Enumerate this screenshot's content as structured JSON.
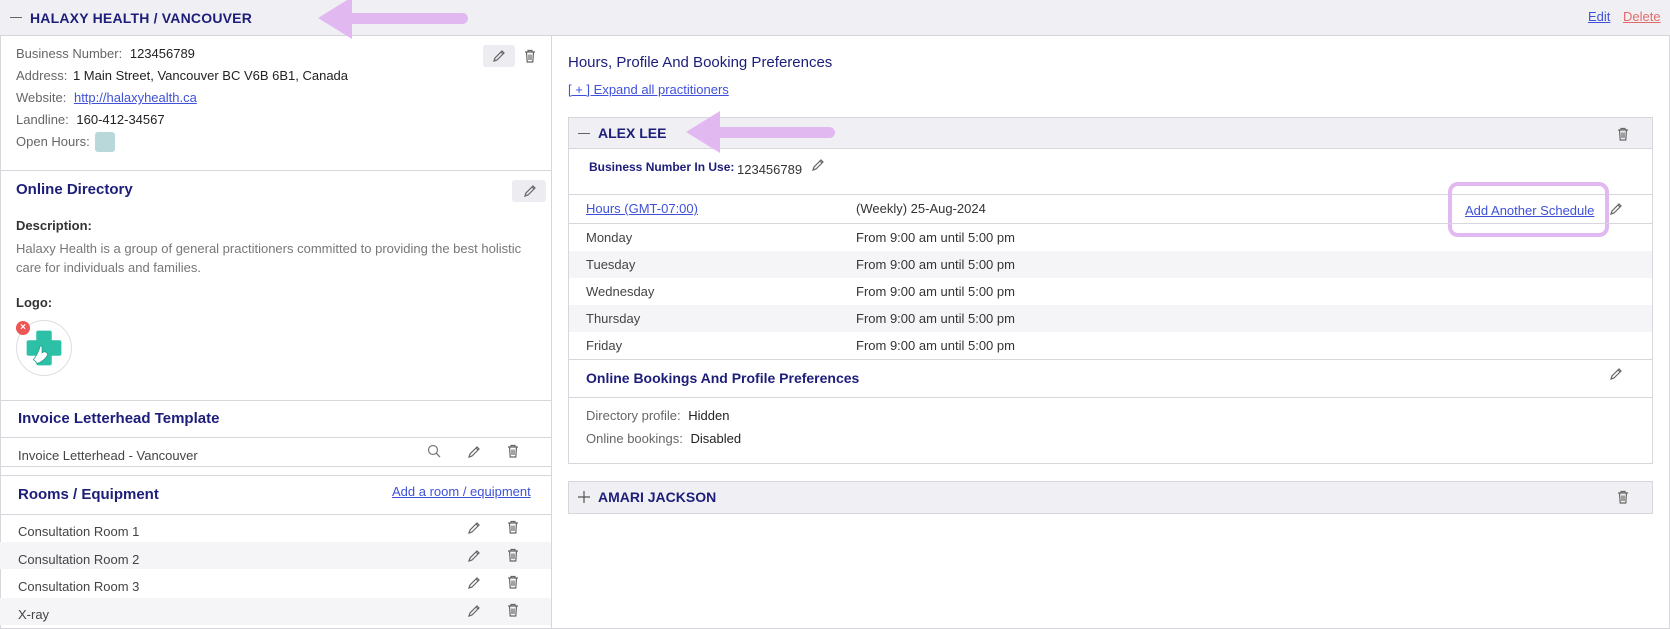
{
  "header": {
    "title": "HALAXY HEALTH / VANCOUVER",
    "edit_label": "Edit",
    "delete_label": "Delete"
  },
  "business": {
    "number_label": "Business Number:",
    "number": "123456789",
    "address_label": "Address:",
    "address": "1 Main Street, Vancouver BC V6B 6B1, Canada",
    "website_label": "Website:",
    "website": "http://halaxyhealth.ca",
    "landline_label": "Landline:",
    "landline": "160-412-34567",
    "open_hours_label": "Open Hours:",
    "open_hours_color": "#b8d8da"
  },
  "online_directory": {
    "title": "Online Directory",
    "description_label": "Description:",
    "description_line1": "Halaxy Health is a group of general practitioners committed to providing the best holistic",
    "description_line2": "care for individuals and families.",
    "logo_label": "Logo:"
  },
  "invoice": {
    "title": "Invoice Letterhead Template",
    "item": "Invoice Letterhead - Vancouver"
  },
  "rooms": {
    "title": "Rooms / Equipment",
    "add_label": "Add a room / equipment",
    "items": [
      "Consultation Room 1",
      "Consultation Room 2",
      "Consultation Room 3",
      "X-ray"
    ]
  },
  "hours_panel": {
    "title": "Hours, Profile And Booking Preferences",
    "expand_label": "[ + ] Expand all practitioners"
  },
  "practitioner1": {
    "name": "ALEX LEE",
    "bn_label": "Business Number In Use:",
    "bn_value": "123456789",
    "hours_link": "Hours (GMT-07:00)",
    "schedule": "(Weekly) 25-Aug-2024",
    "add_schedule_label": "Add Another Schedule",
    "days": [
      {
        "day": "Monday",
        "time": "From 9:00 am until 5:00 pm"
      },
      {
        "day": "Tuesday",
        "time": "From 9:00 am until 5:00 pm"
      },
      {
        "day": "Wednesday",
        "time": "From 9:00 am until 5:00 pm"
      },
      {
        "day": "Thursday",
        "time": "From 9:00 am until 5:00 pm"
      },
      {
        "day": "Friday",
        "time": "From 9:00 am until 5:00 pm"
      }
    ],
    "prefs_title": "Online Bookings And Profile Preferences",
    "directory_label": "Directory profile:",
    "directory_value": "Hidden",
    "bookings_label": "Online bookings:",
    "bookings_value": "Disabled"
  },
  "practitioner2": {
    "name": "AMARI JACKSON"
  },
  "colors": {
    "accent": "#1d1d7a",
    "link": "#3f51d8",
    "danger": "#e46a6a",
    "annotation": "#e2b8f0"
  }
}
